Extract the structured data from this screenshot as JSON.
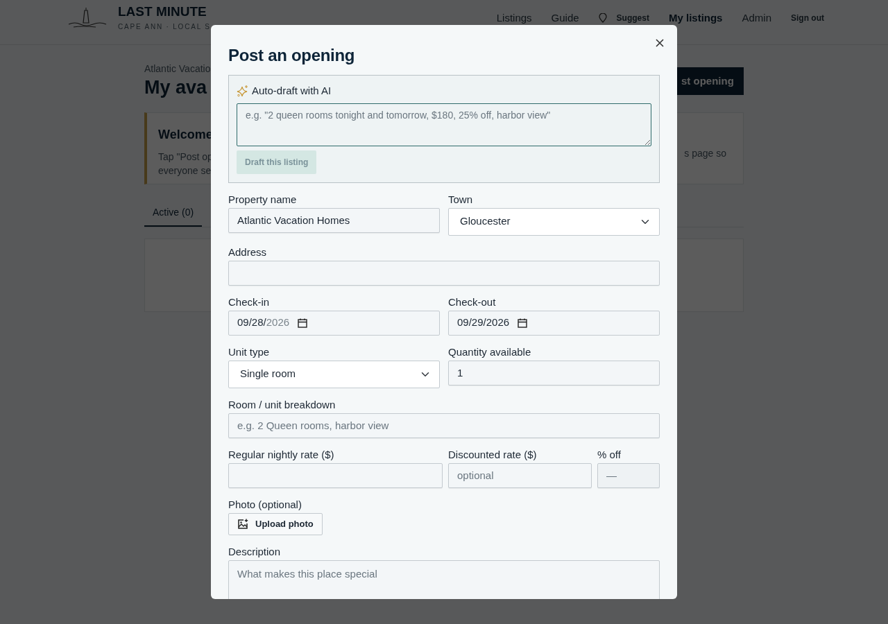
{
  "navbar": {
    "brand_title": "LAST MINUTE",
    "brand_subtitle": "CAPE ANN · LOCAL S",
    "links": [
      {
        "label": "Listings",
        "kind": "link",
        "selected": false
      },
      {
        "label": "Guide",
        "kind": "link",
        "selected": false
      },
      {
        "label": "Suggest",
        "kind": "pin",
        "selected": false
      },
      {
        "label": "My listings",
        "kind": "link",
        "selected": true
      },
      {
        "label": "Admin",
        "kind": "link",
        "selected": false
      },
      {
        "label": "Sign out",
        "kind": "small",
        "selected": false
      }
    ]
  },
  "page": {
    "breadcrumb": "Atlantic Vacatio",
    "heading": "My ava",
    "post_button": "st opening",
    "welcome": {
      "title": "Welcome",
      "lines_left": [
        "Tap \"Post op",
        "everyone se"
      ],
      "line_right": "s page so"
    },
    "tabs": [
      {
        "label": "Active (0)",
        "selected": true
      }
    ]
  },
  "modal": {
    "title": "Post an opening",
    "ai": {
      "title": "Auto-draft with AI",
      "placeholder": "e.g. \"2 queen rooms tonight and tomorrow, $180, 25% off, harbor view\"",
      "button": "Draft this listing",
      "button_disabled": true
    },
    "rows": [
      [
        {
          "kind": "text",
          "label": "Property name",
          "value": "Atlantic Vacation Homes"
        },
        {
          "kind": "select",
          "label": "Town",
          "value": "Gloucester"
        }
      ],
      [
        {
          "kind": "text",
          "label": "Address"
        }
      ],
      [
        {
          "kind": "date",
          "label": "Check-in",
          "segments": [
            {
              "text": "09/28/",
              "dim": false
            },
            {
              "text": "2026",
              "dim": true
            }
          ]
        },
        {
          "kind": "date",
          "label": "Check-out",
          "segments": [
            {
              "text": "09/29/2026",
              "dim": false
            }
          ]
        }
      ],
      [
        {
          "kind": "select",
          "label": "Unit type",
          "value": "Single room"
        },
        {
          "kind": "text",
          "label": "Quantity available",
          "value": "1"
        }
      ],
      [
        {
          "kind": "text",
          "label": "Room / unit breakdown",
          "placeholder": "e.g. 2 Queen rooms, harbor view"
        }
      ],
      [
        {
          "kind": "text",
          "label": "Regular nightly rate ($)"
        },
        {
          "kind": "text",
          "label": "Discounted rate ($)",
          "placeholder": "optional"
        },
        {
          "kind": "readonly",
          "label": "% off",
          "placeholder": "—"
        }
      ],
      [
        {
          "kind": "upload",
          "label": "Photo (optional)",
          "button": "Upload photo"
        }
      ],
      [
        {
          "kind": "textarea",
          "label": "Description",
          "placeholder": "What makes this place special"
        }
      ]
    ]
  }
}
